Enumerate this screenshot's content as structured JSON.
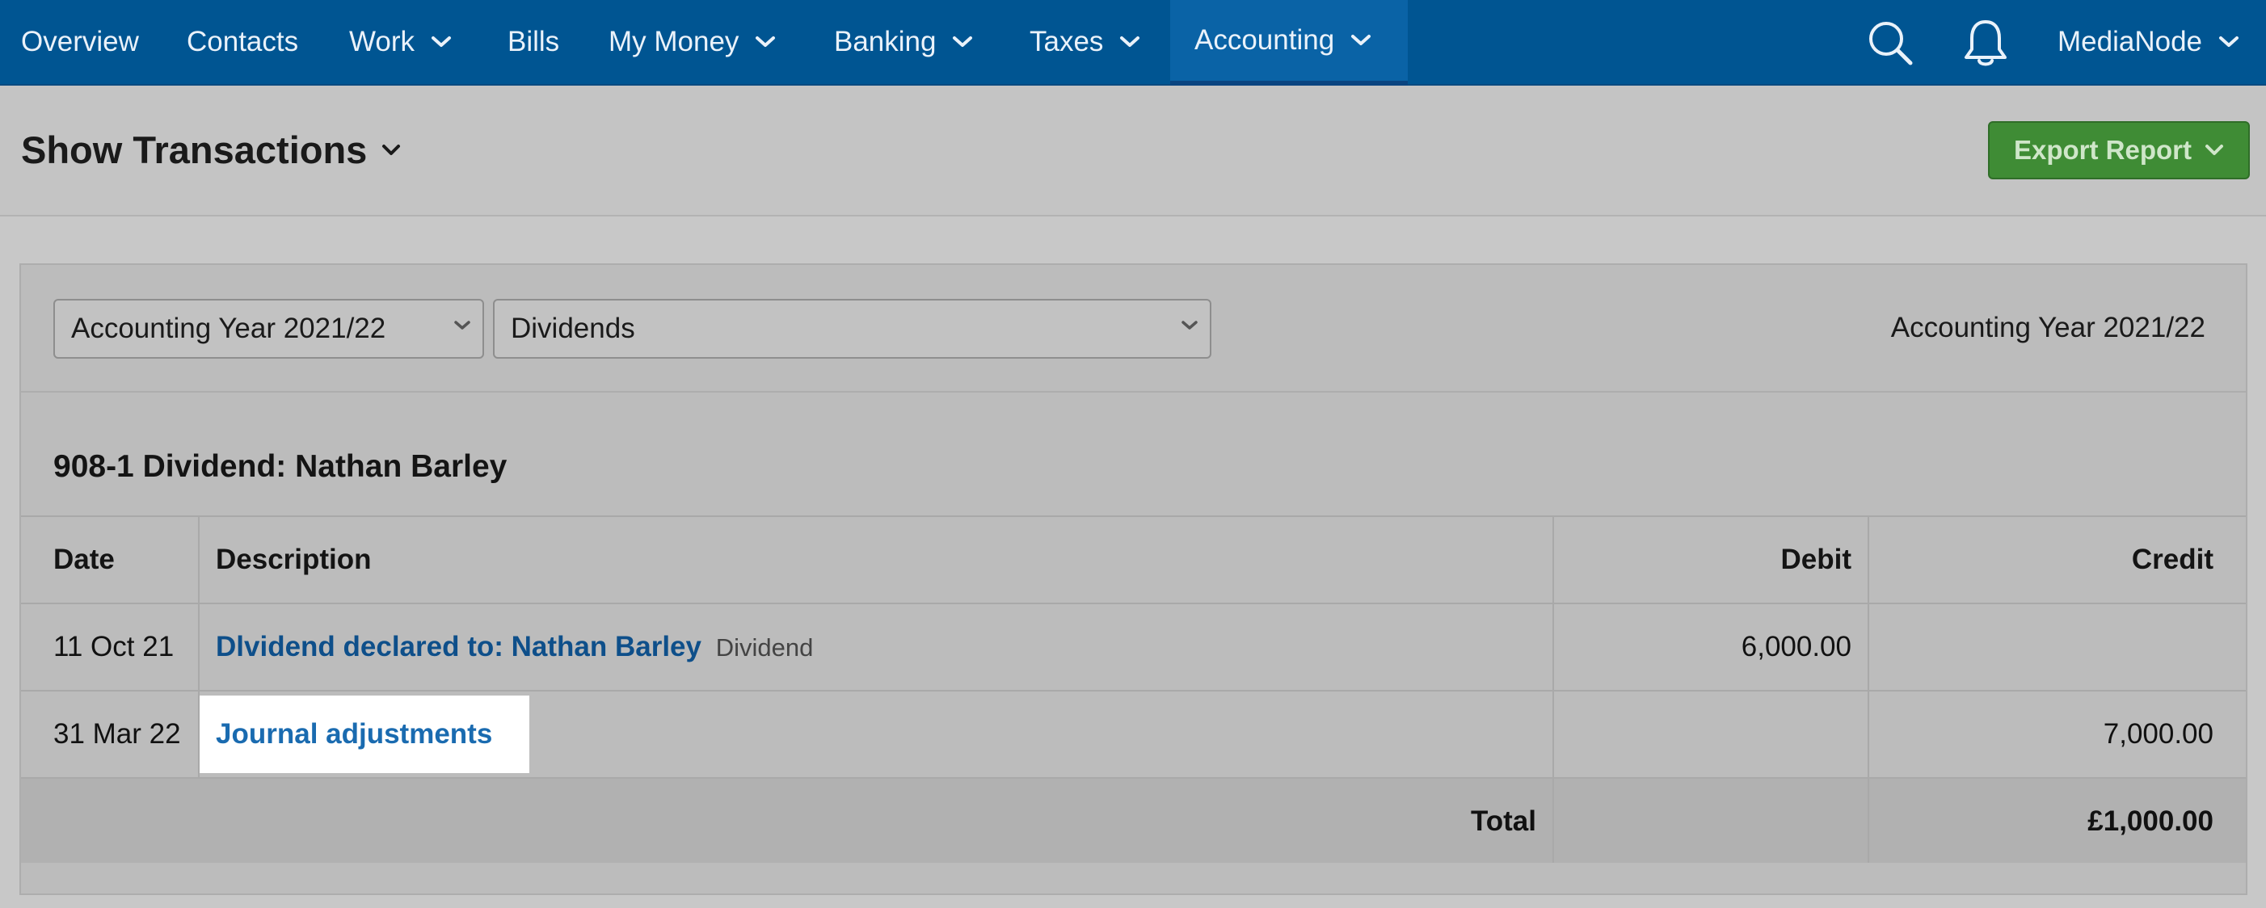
{
  "nav": {
    "items": [
      {
        "label": "Overview",
        "dropdown": false
      },
      {
        "label": "Contacts",
        "dropdown": false
      },
      {
        "label": "Work",
        "dropdown": true
      },
      {
        "label": "Bills",
        "dropdown": false
      },
      {
        "label": "My Money",
        "dropdown": true
      },
      {
        "label": "Banking",
        "dropdown": true
      },
      {
        "label": "Taxes",
        "dropdown": true
      },
      {
        "label": "Accounting",
        "dropdown": true,
        "active": true
      }
    ],
    "search_icon": "search-icon",
    "notifications_icon": "bell-icon",
    "account_label": "MediaNode"
  },
  "header": {
    "title": "Show Transactions",
    "export_label": "Export Report"
  },
  "filters": {
    "period_select": "Accounting Year 2021/22",
    "category_select": "Dividends",
    "period_label": "Accounting Year 2021/22"
  },
  "account": {
    "title": "908-1 Dividend: Nathan Barley"
  },
  "table": {
    "columns": {
      "date": "Date",
      "description": "Description",
      "debit": "Debit",
      "credit": "Credit"
    },
    "rows": [
      {
        "date": "11 Oct 21",
        "description": "Dlvidend declared to: Nathan Barley",
        "tag": "Dividend",
        "debit": "6,000.00",
        "credit": ""
      },
      {
        "date": "31 Mar 22",
        "description": "Journal adjustments",
        "tag": "",
        "debit": "",
        "credit": "7,000.00"
      }
    ],
    "total_label": "Total",
    "total_debit": "",
    "total_credit": "£1,000.00"
  },
  "colors": {
    "nav_bg": "#005592",
    "export_green": "#3f8c35",
    "link_blue": "#0e4f8a"
  }
}
